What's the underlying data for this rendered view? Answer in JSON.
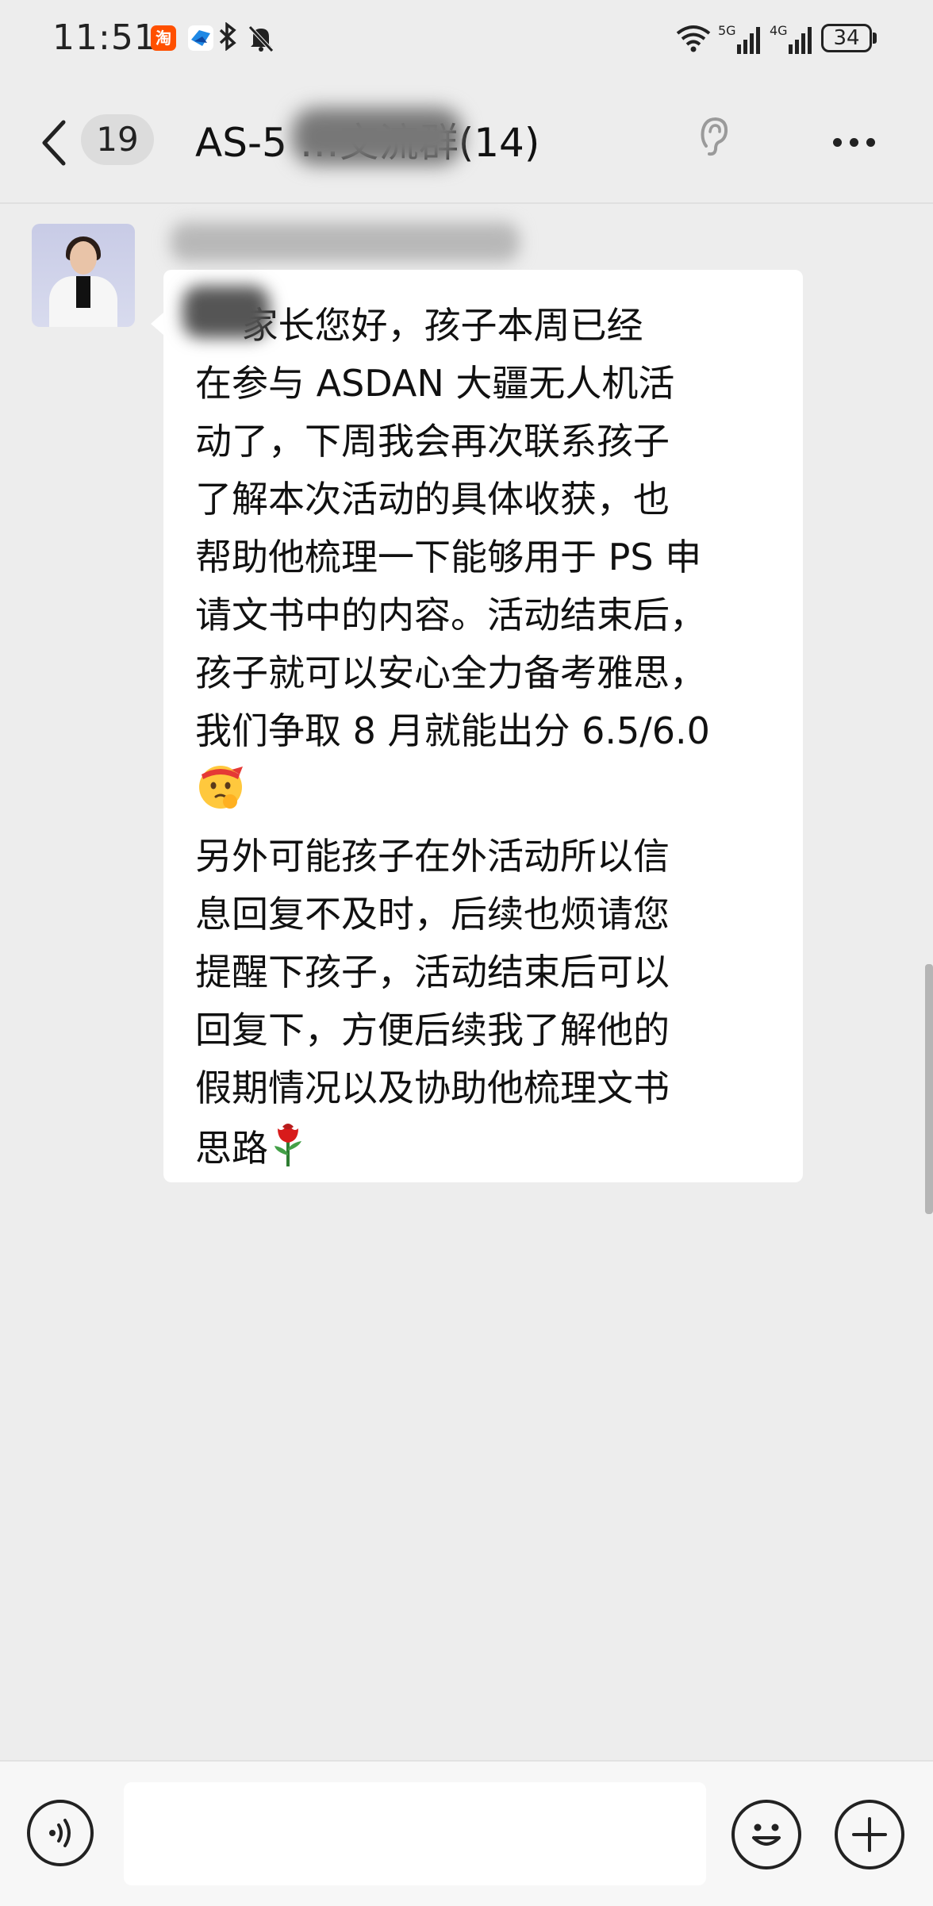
{
  "status_bar": {
    "time": "11:51",
    "taobao_glyph": "淘",
    "signal_5g": "5G",
    "signal_4g": "4G",
    "battery": "34"
  },
  "header": {
    "unread_count": "19",
    "title": "AS-5          …交流群(14)"
  },
  "message": {
    "text_before_emoji": "    家长您好，孩子本周已经\n在参与 ASDAN 大疆无人机活\n动了，下周我会再次联系孩子\n了解本次活动的具体收获，也\n帮助他梳理一下能够用于 PS 申\n请文书中的内容。活动结束后，\n孩子就可以安心全力备考雅思，\n我们争取 8 月就能出分 6.5/6.0\n",
    "text_after_emoji": "\n另外可能孩子在外活动所以信\n息回复不及时，后续也烦请您\n提醒下孩子，活动结束后可以\n回复下，方便后续我了解他的\n假期情况以及协助他梳理文书\n思路",
    "emoji_1": "determined-face-emoji",
    "emoji_2": "rose-emoji"
  },
  "input_bar": {
    "input_value": ""
  },
  "icons": [
    "back-icon",
    "ear-icon",
    "more-icon",
    "voice-icon",
    "emoji-icon",
    "plus-icon",
    "wifi-icon",
    "bluetooth-icon",
    "mute-icon"
  ],
  "colors": {
    "background": "#ededed",
    "bubble": "#ffffff",
    "input_bar": "#f7f7f7"
  }
}
